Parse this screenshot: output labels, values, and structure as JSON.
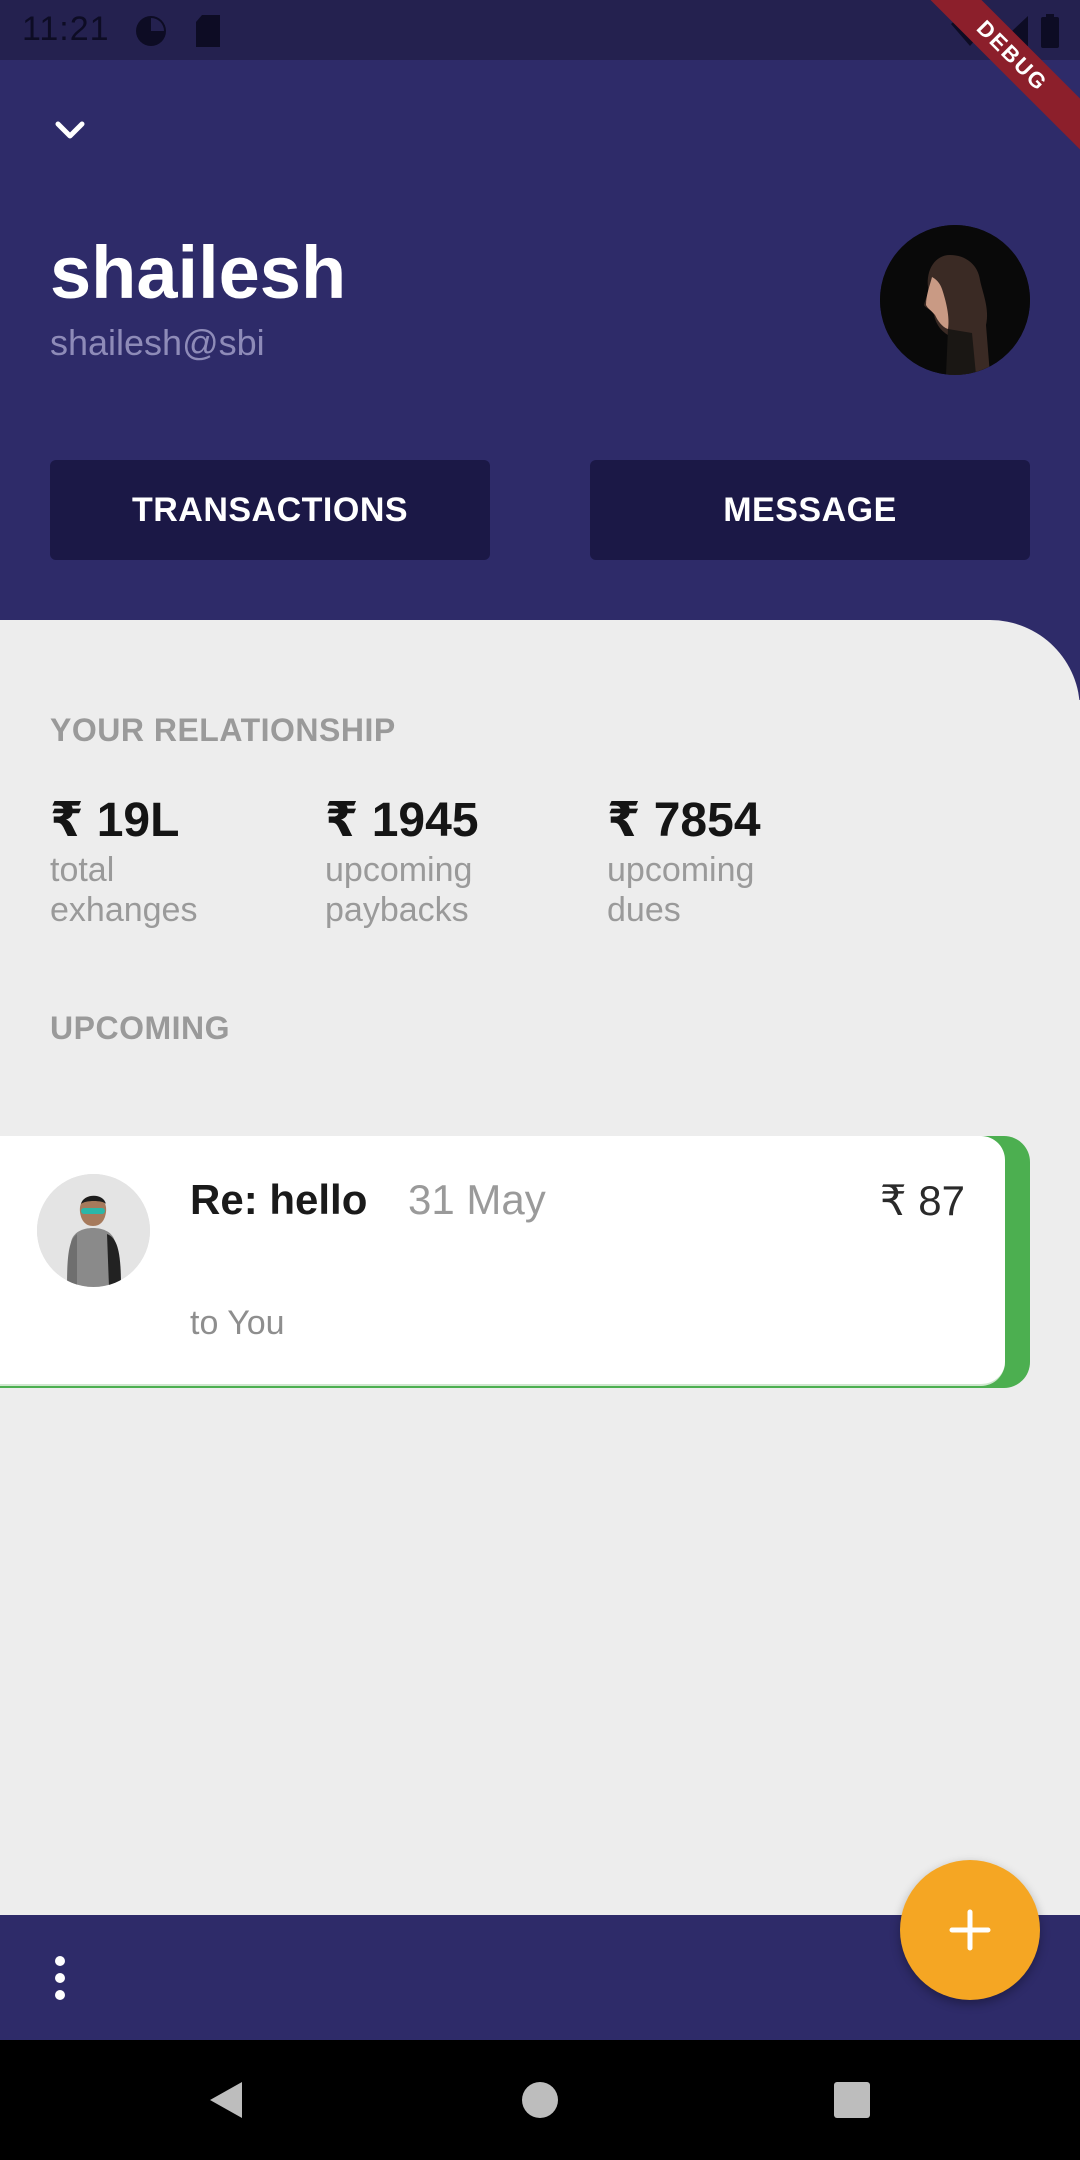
{
  "status_bar": {
    "time": "11:21"
  },
  "debug_banner": {
    "label": "DEBUG"
  },
  "profile": {
    "name": "shailesh",
    "handle": "shailesh@sbi"
  },
  "actions": {
    "transactions_label": "TRANSACTIONS",
    "message_label": "MESSAGE"
  },
  "relationship": {
    "section_label": "YOUR RELATIONSHIP",
    "stats": [
      {
        "value": "₹ 19L",
        "caption_line1": "total",
        "caption_line2": "exhanges"
      },
      {
        "value": "₹ 1945",
        "caption_line1": "upcoming",
        "caption_line2": "paybacks"
      },
      {
        "value": "₹ 7854",
        "caption_line1": "upcoming",
        "caption_line2": "dues"
      }
    ]
  },
  "upcoming": {
    "section_label": "UPCOMING",
    "items": [
      {
        "title": "Re: hello",
        "date": "31 May",
        "amount": "₹ 87",
        "subtitle": "to You",
        "accent_color": "#4caf50"
      }
    ]
  },
  "colors": {
    "header": "#2e2b69",
    "button": "#1b1846",
    "fab": "#f5a623",
    "accent_green": "#4caf50"
  },
  "icons": {
    "collapse": "chevron-down-icon",
    "menu": "more-vert-icon",
    "fab": "plus-icon",
    "nav_back": "back-triangle-icon",
    "nav_home": "home-circle-icon",
    "nav_recents": "recents-square-icon"
  }
}
